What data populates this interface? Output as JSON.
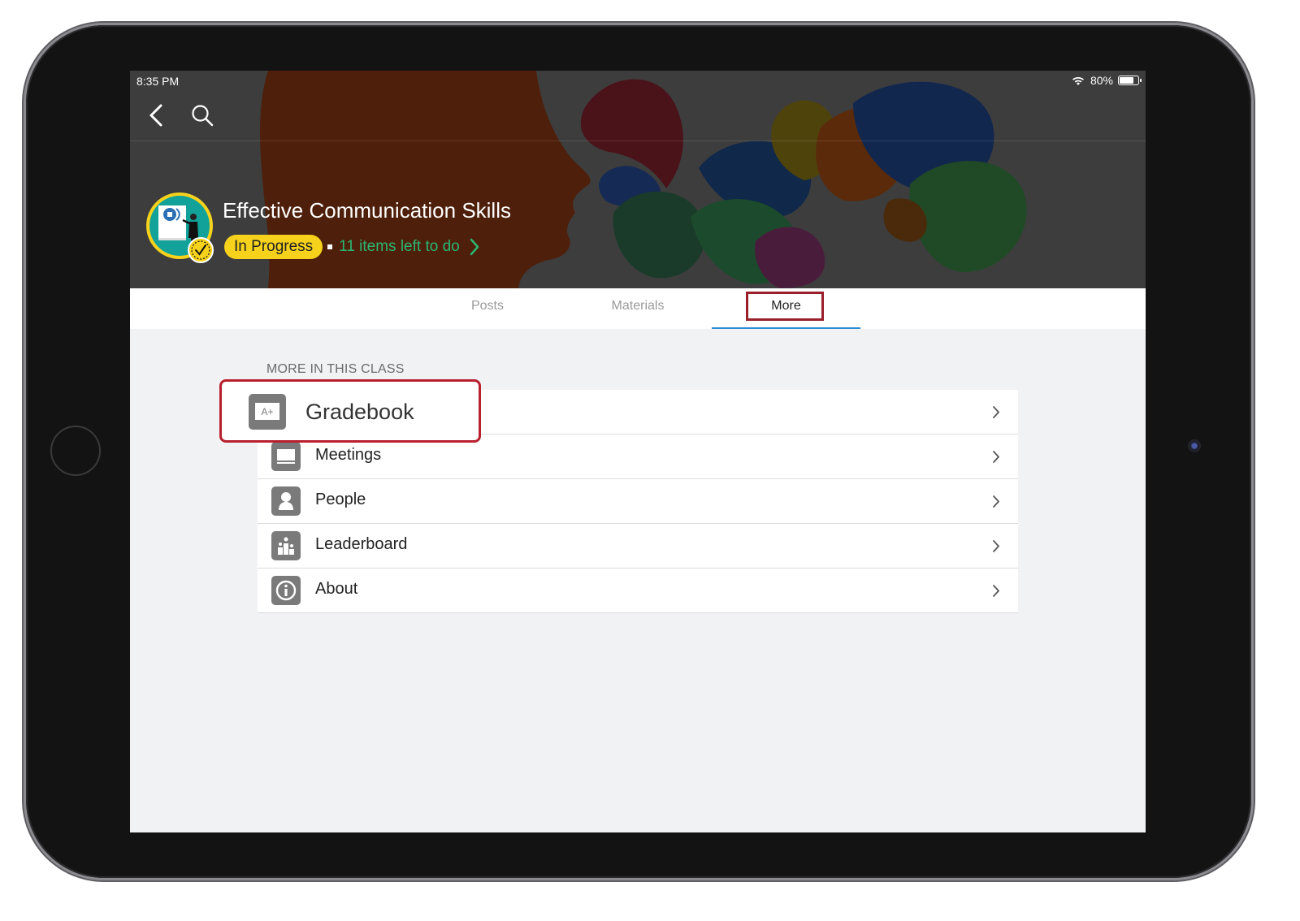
{
  "status_bar": {
    "time": "8:35 PM",
    "battery": "80%",
    "battery_level": 0.8
  },
  "nav": {
    "back_icon": "back-chevron-icon",
    "search_icon": "search-icon"
  },
  "course": {
    "title": "Effective Communication Skills",
    "status": "In Progress",
    "todo": "11 items left to do",
    "icon": "presenter-badge-icon"
  },
  "tabs": [
    {
      "label": "Posts"
    },
    {
      "label": "Materials"
    },
    {
      "label": "More",
      "selected": true
    }
  ],
  "section": {
    "header": "MORE IN THIS CLASS"
  },
  "items": [
    {
      "label": "Gradebook",
      "icon": "grade-a-plus-icon"
    },
    {
      "label": "Meetings",
      "icon": "monitor-icon"
    },
    {
      "label": "People",
      "icon": "person-icon"
    },
    {
      "label": "Leaderboard",
      "icon": "podium-icon"
    },
    {
      "label": "About",
      "icon": "info-icon"
    }
  ],
  "colors": {
    "accent_tab": "#2a8bd6",
    "status_badge": "#f6d21c",
    "todo_link": "#2bb673",
    "highlight": "#b8202e"
  }
}
